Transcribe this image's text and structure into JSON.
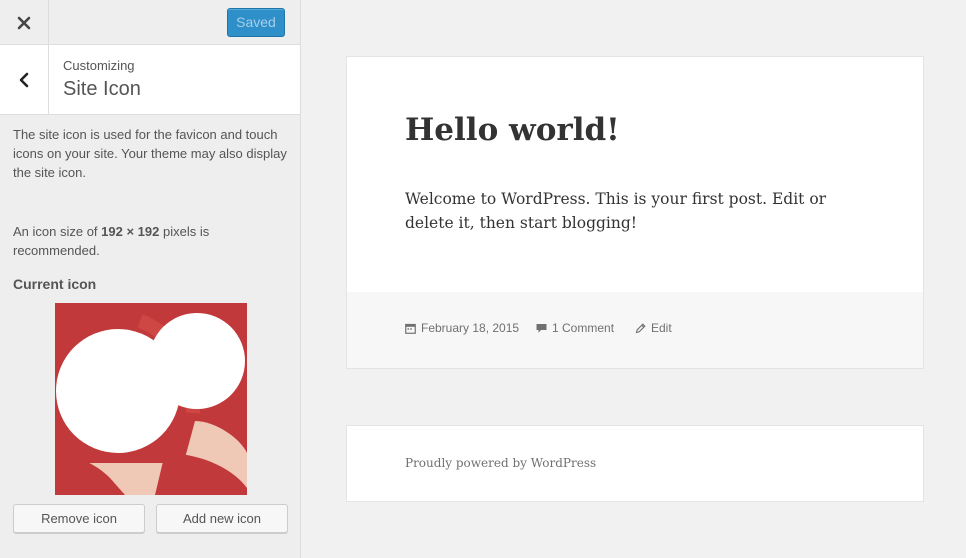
{
  "sidebar": {
    "close_icon": "close-icon",
    "saved_label": "Saved",
    "back_icon": "chevron-left-icon",
    "crumb": "Customizing",
    "title": "Site Icon",
    "description": "The site icon is used for the favicon and touch icons on your site. Your theme may also display the site icon.",
    "size_note_prefix": "An icon size of ",
    "size_note_size": "192 × 192",
    "size_note_suffix": " pixels is recommended.",
    "current_label": "Current icon",
    "remove_label": "Remove icon",
    "add_label": "Add new icon",
    "icon_colors": {
      "red": "#c1393a",
      "pink": "#f0c8b6",
      "white": "#ffffff"
    }
  },
  "preview": {
    "post_title": "Hello world!",
    "post_body": "Welcome to WordPress. This is your first post. Edit or delete it, then start blogging!",
    "date": "February 18, 2015",
    "comments": "1 Comment",
    "edit": "Edit",
    "footer": "Proudly powered by WordPress"
  },
  "colors": {
    "accent": "#2e8fc9"
  }
}
